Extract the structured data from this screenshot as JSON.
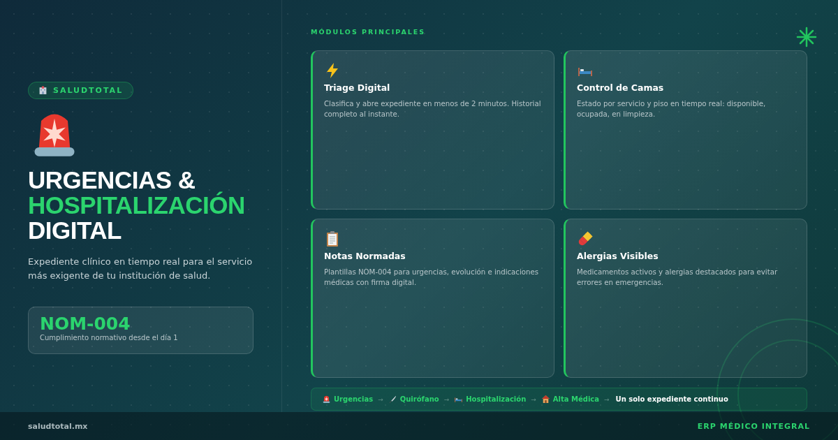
{
  "brand": {
    "badge": "SALUDTOTAL"
  },
  "hero": {
    "title_line_1": "URGENCIAS &",
    "title_line_2": "HOSPITALIZACIÓN",
    "title_line_3": "DIGITAL",
    "subtitle": "Expediente clínico en tiempo real para el servicio más exigente de tu institución de salud."
  },
  "stat": {
    "value": "NOM-004",
    "caption": "Cumplimiento normativo desde el día 1"
  },
  "modules": {
    "heading": "MÓDULOS PRINCIPALES",
    "cards": [
      {
        "title": "Triage Digital",
        "description": "Clasifica y abre expediente en menos de 2 minutos. Historial completo al instante."
      },
      {
        "title": "Control de Camas",
        "description": "Estado por servicio y piso en tiempo real: disponible, ocupada, en limpieza."
      },
      {
        "title": "Notas Normadas",
        "description": "Plantillas NOM-004 para urgencias, evolución e indicaciones médicas con firma digital."
      },
      {
        "title": "Alergias Visibles",
        "description": "Medicamentos activos y alergias destacados para evitar errores en emergencias."
      }
    ]
  },
  "flow": [
    {
      "kind": "step",
      "label": "Urgencias"
    },
    {
      "kind": "arrow",
      "label": "→"
    },
    {
      "kind": "step",
      "label": "Quirófano"
    },
    {
      "kind": "arrow",
      "label": "→"
    },
    {
      "kind": "step",
      "label": "Hospitalización"
    },
    {
      "kind": "arrow",
      "label": "→"
    },
    {
      "kind": "step",
      "label": "Alta Médica"
    },
    {
      "kind": "arrow",
      "label": "→"
    },
    {
      "kind": "note",
      "label": "Un solo expediente continuo"
    }
  ],
  "footer": {
    "site": "saludtotal.mx",
    "tagline": "ERP MÉDICO INTEGRAL"
  }
}
